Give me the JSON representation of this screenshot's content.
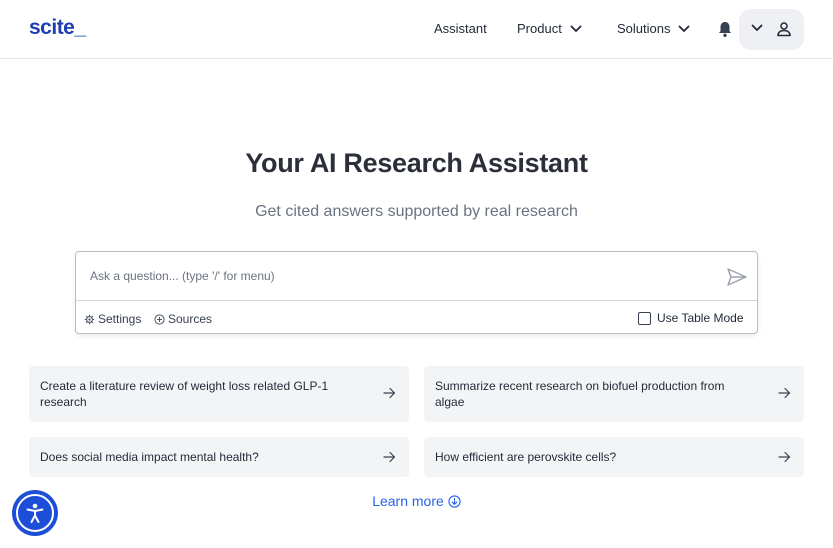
{
  "header": {
    "logo": "scite_",
    "nav": {
      "assistant": "Assistant",
      "product": "Product",
      "solutions": "Solutions"
    }
  },
  "hero": {
    "title": "Your AI Research Assistant",
    "subtitle": "Get cited answers supported by real research"
  },
  "ask": {
    "placeholder": "Ask a question... (type '/' for menu)",
    "value": "",
    "settings_label": "Settings",
    "sources_label": "Sources",
    "table_mode_label": "Use Table Mode",
    "table_mode_checked": false
  },
  "suggestions": [
    "Create a literature review of weight loss related GLP-1 research",
    "Summarize recent research on biofuel production from algae",
    "Does social media impact mental health?",
    "How efficient are perovskite cells?"
  ],
  "learn_more": "Learn more",
  "colors": {
    "brand": "#1e40af",
    "link": "#2563eb",
    "card_bg": "#f3f4f6",
    "a11y_button": "#1d4ed8"
  },
  "icons": [
    "bell-icon",
    "chevron-down-icon",
    "person-icon",
    "send-icon",
    "gear-icon",
    "plus-circle-icon",
    "arrow-right-icon",
    "arrow-down-circle-icon",
    "accessibility-icon"
  ]
}
